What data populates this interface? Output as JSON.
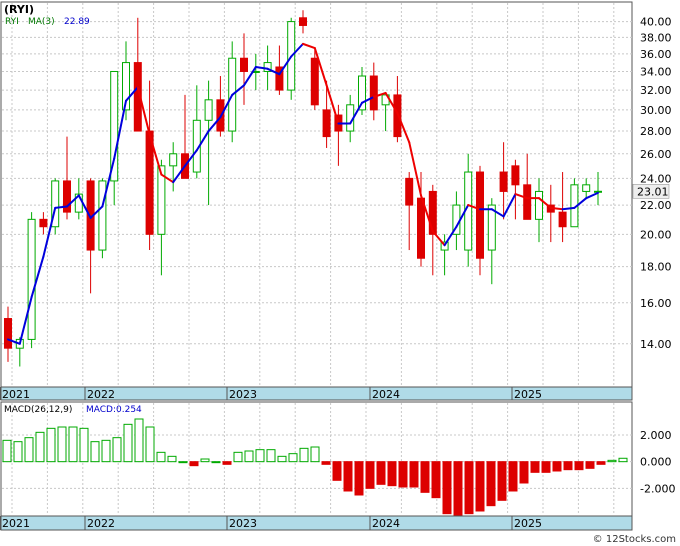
{
  "chart_data": [
    {
      "type": "candlestick",
      "title": "(RYI)",
      "legend": {
        "symbol": "RYI",
        "ma_label": "MA(3)",
        "ma_value": "22.89",
        "position": "top-left"
      },
      "last_price_label": "23.01",
      "y_ticks": [
        "14.00",
        "16.00",
        "18.00",
        "20.00",
        "22.00",
        "24.00",
        "26.00",
        "28.00",
        "30.00",
        "32.00",
        "34.00",
        "36.00",
        "38.00",
        "40.00"
      ],
      "y_scale": "log",
      "ylim": [
        12.2,
        42.5
      ],
      "x_labels": [
        "2021",
        "2022",
        "2023",
        "2024",
        "2025"
      ],
      "x_label_index": [
        0,
        7,
        19,
        31,
        43
      ],
      "grid": true,
      "colors": {
        "up": "#00aa00",
        "down": "#dd0000",
        "ma_up": "#0000dd",
        "ma_down": "#ee0000",
        "axis_band": "#b0dbe8"
      },
      "ohlc": [
        [
          15.2,
          15.8,
          13.2,
          13.8
        ],
        [
          13.8,
          14.3,
          13.0,
          14.2
        ],
        [
          14.2,
          21.5,
          13.8,
          21.0
        ],
        [
          21.0,
          21.5,
          20.0,
          20.5
        ],
        [
          20.5,
          24.0,
          20.0,
          23.8
        ],
        [
          23.8,
          27.5,
          21.0,
          21.5
        ],
        [
          21.5,
          24.0,
          21.0,
          22.8
        ],
        [
          23.8,
          24.0,
          16.5,
          19.0
        ],
        [
          19.0,
          24.0,
          18.5,
          23.8
        ],
        [
          23.8,
          34.0,
          22.0,
          34.0
        ],
        [
          30.0,
          37.5,
          29.0,
          35.0
        ],
        [
          35.0,
          40.5,
          29.5,
          28.0
        ],
        [
          28.0,
          33.0,
          19.0,
          20.0
        ],
        [
          20.0,
          25.5,
          17.5,
          25.0
        ],
        [
          25.0,
          27.0,
          23.0,
          26.0
        ],
        [
          26.0,
          31.5,
          24.5,
          24.0
        ],
        [
          24.5,
          32.5,
          24.0,
          29.0
        ],
        [
          29.0,
          33.0,
          22.0,
          31.0
        ],
        [
          31.0,
          33.5,
          27.5,
          28.0
        ],
        [
          28.0,
          37.5,
          27.0,
          35.5
        ],
        [
          35.5,
          38.5,
          30.5,
          34.0
        ],
        [
          34.0,
          36.0,
          32.0,
          34.0
        ],
        [
          34.0,
          37.0,
          32.0,
          35.0
        ],
        [
          34.5,
          37.0,
          31.5,
          32.0
        ],
        [
          32.0,
          40.5,
          31.0,
          40.0
        ],
        [
          40.5,
          41.5,
          38.5,
          39.5
        ],
        [
          35.5,
          36.5,
          30.0,
          30.5
        ],
        [
          30.0,
          33.0,
          26.5,
          27.5
        ],
        [
          29.5,
          30.5,
          25.0,
          28.0
        ],
        [
          28.0,
          31.5,
          27.0,
          30.5
        ],
        [
          30.0,
          34.5,
          29.5,
          33.5
        ],
        [
          33.5,
          35.0,
          29.0,
          30.0
        ],
        [
          30.5,
          31.5,
          28.0,
          31.5
        ],
        [
          31.5,
          33.5,
          27.0,
          27.5
        ],
        [
          24.0,
          24.5,
          19.0,
          22.0
        ],
        [
          22.5,
          24.5,
          18.0,
          18.5
        ],
        [
          23.0,
          23.5,
          17.5,
          20.0
        ],
        [
          19.0,
          20.0,
          17.5,
          19.5
        ],
        [
          20.0,
          23.0,
          19.0,
          22.0
        ],
        [
          19.0,
          26.0,
          18.0,
          24.5
        ],
        [
          24.5,
          25.0,
          17.5,
          18.5
        ],
        [
          19.0,
          22.5,
          17.0,
          22.0
        ],
        [
          24.5,
          27.0,
          21.0,
          23.0
        ],
        [
          25.0,
          25.5,
          21.0,
          23.5
        ],
        [
          23.5,
          26.0,
          21.0,
          21.0
        ],
        [
          21.0,
          24.0,
          19.5,
          23.0
        ],
        [
          22.0,
          23.5,
          19.5,
          21.5
        ],
        [
          21.5,
          24.5,
          19.5,
          20.5
        ],
        [
          20.5,
          24.0,
          20.5,
          23.5
        ],
        [
          23.0,
          24.0,
          22.5,
          23.5
        ],
        [
          23.0,
          24.5,
          22.0,
          23.01
        ]
      ],
      "ma3": [
        14.2,
        14.0,
        16.3,
        18.6,
        21.8,
        21.9,
        22.7,
        21.1,
        21.9,
        25.6,
        30.9,
        32.3,
        27.7,
        24.3,
        23.7,
        25.0,
        26.3,
        28.0,
        29.3,
        31.5,
        32.5,
        34.5,
        34.3,
        33.7,
        35.7,
        37.2,
        36.7,
        32.5,
        28.7,
        28.7,
        30.7,
        31.3,
        31.7,
        29.7,
        27.0,
        22.7,
        20.2,
        19.3,
        20.5,
        22.0,
        21.7,
        21.7,
        21.2,
        22.8,
        22.5,
        22.5,
        21.8,
        21.7,
        21.8,
        22.5,
        22.89
      ],
      "ma_color_index": [
        0,
        0,
        0,
        0,
        0,
        0,
        0,
        0,
        0,
        0,
        0,
        0,
        1,
        1,
        1,
        0,
        0,
        0,
        0,
        0,
        0,
        0,
        0,
        0,
        0,
        0,
        1,
        1,
        1,
        0,
        0,
        0,
        1,
        1,
        1,
        1,
        1,
        1,
        0,
        0,
        1,
        0,
        0,
        0,
        1,
        1,
        1,
        1,
        0,
        0,
        0
      ]
    },
    {
      "type": "bar",
      "title": "MACD(26,12,9)",
      "macd_label": "MACD:0.254",
      "y_ticks": [
        "2.000",
        "0.000",
        "-2.000"
      ],
      "ylim": [
        -4.0,
        4.4
      ],
      "x_labels": [
        "2021",
        "2022",
        "2023",
        "2024",
        "2025"
      ],
      "histogram": [
        1.6,
        1.5,
        1.8,
        2.2,
        2.5,
        2.6,
        2.6,
        2.5,
        1.5,
        1.6,
        1.8,
        2.8,
        3.2,
        2.6,
        0.7,
        0.4,
        0.0,
        -0.3,
        0.2,
        0.0,
        -0.2,
        0.7,
        0.8,
        0.9,
        0.9,
        0.4,
        0.6,
        1.0,
        1.1,
        -0.2,
        -1.4,
        -2.2,
        -2.5,
        -2.0,
        -1.7,
        -1.8,
        -1.9,
        -1.9,
        -2.3,
        -2.7,
        -3.9,
        -4.0,
        -3.9,
        -3.7,
        -3.3,
        -2.9,
        -2.2,
        -1.6,
        -0.8,
        -0.8,
        -0.7,
        -0.6,
        -0.6,
        -0.5,
        -0.2,
        0.1,
        0.254
      ]
    }
  ],
  "watermark": "© 12Stocks.com"
}
